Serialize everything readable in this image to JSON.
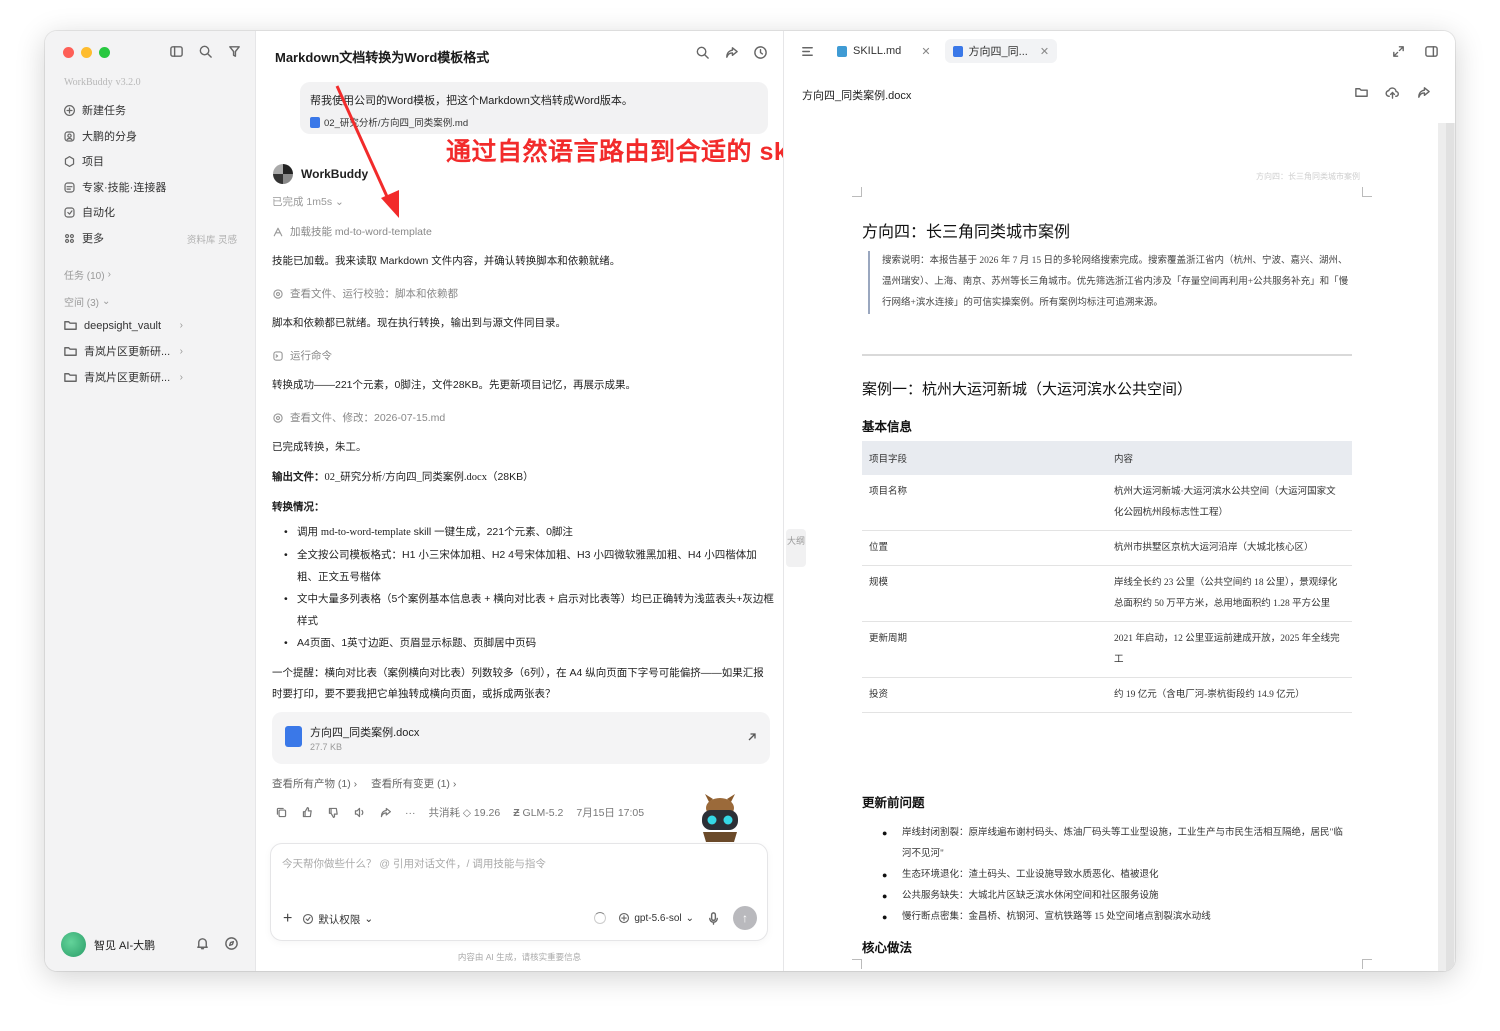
{
  "sidebar": {
    "brand": "WorkBuddy",
    "version": "v3.2.0",
    "nav": [
      {
        "label": "新建任务",
        "icon": "plus-circle-icon"
      },
      {
        "label": "大鹏的分身",
        "icon": "avatar-icon"
      },
      {
        "label": "项目",
        "icon": "project-icon"
      },
      {
        "label": "专家·技能·连接器",
        "icon": "expert-icon"
      },
      {
        "label": "自动化",
        "icon": "automation-icon"
      },
      {
        "label": "更多",
        "icon": "grid-icon",
        "extra": "资料库 灵感"
      }
    ],
    "tasks_label": "任务 (10)",
    "spaces_label": "空间 (3)",
    "folders": [
      "deepsight_vault",
      "青岚片区更新研...",
      "青岚片区更新研..."
    ],
    "user_name": "智见 AI-大鹏"
  },
  "chat": {
    "title": "Markdown文档转换为Word模板格式",
    "user_message": "帮我使用公司的Word模板，把这个Markdown文档转成Word版本。",
    "attachment": "02_研究分析/方向四_同类案例.md",
    "annotation": "通过自然语言路由到合适的 skill",
    "bot_name": "WorkBuddy",
    "done": "已完成 1m5s",
    "steps": {
      "load_skill": "加载技能 md-to-word-template",
      "check_env": "查看文件、运行校验：脚本和依赖都",
      "run_cmd": "运行命令",
      "check_file": "查看文件、修改：2026-07-15.md"
    },
    "paragraphs": {
      "p1": "技能已加载。我来读取 Markdown 文件内容，并确认转换脚本和依赖就绪。",
      "p2": "脚本和依赖都已就绪。现在执行转换，输出到与源文件同目录。",
      "p3": "转换成功——221个元素，0脚注，文件28KB。先更新项目记忆，再展示成果。",
      "p4": "已完成转换，朱工。",
      "output_label": "输出文件：",
      "output_path": "02_研究分析/方向四_同类案例.docx",
      "output_size": "（28KB）",
      "summary_label": "转换情况：",
      "reminder": "一个提醒：横向对比表（案例横向对比表）列数较多（6列），在 A4 纵向页面下字号可能偏挤——如果汇报时要打印，要不要我把它单独转成横向页面，或拆成两张表？"
    },
    "bullets": [
      {
        "pre": "调用 ",
        "code": "md-to-word-template",
        "post": " skill 一键生成，221个元素、0脚注"
      },
      {
        "pre": "全文按公司模板格式：H1 小三宋体加粗、H2 4号宋体加粗、H3 小四微软雅黑加粗、H4 小四楷体加粗、正文五号楷体",
        "code": "",
        "post": ""
      },
      {
        "pre": "文中大量多列表格（5个案例基本信息表 + 横向对比表 + 启示对比表等）均已正确转为浅蓝表头+灰边框样式",
        "code": "",
        "post": ""
      },
      {
        "pre": "A4页面、1英寸边距、页眉显示标题、页脚居中页码",
        "code": "",
        "post": ""
      }
    ],
    "file_card": {
      "name": "方向四_同类案例.docx",
      "size": "27.7 KB"
    },
    "links": [
      "查看所有产物 (1) ›",
      "查看所有变更 (1) ›"
    ],
    "meta": {
      "cost": "共消耗 ◇ 19.26",
      "model": "GLM-5.2",
      "time": "7月15日 17:05"
    },
    "input_placeholder": "今天帮你做些什么？ @ 引用对话文件，/ 调用技能与指令",
    "permission": "默认权限",
    "model_select": "gpt-5.6-sol",
    "disclaimer": "内容由 AI 生成，请核实重要信息",
    "collapse_tab": "大纲"
  },
  "doc": {
    "tabs": [
      {
        "label": "SKILL.md",
        "icon": "markdown-icon",
        "color": "#3f9bd4"
      },
      {
        "label": "方向四_同...",
        "icon": "word-doc-icon",
        "color": "#3a78e8"
      }
    ],
    "file_name": "方向四_同类案例.docx",
    "running_header": "方向四：长三角同类城市案例",
    "h1": "方向四：长三角同类城市案例",
    "quote": "搜索说明：本报告基于 2026 年 7 月 15 日的多轮网络搜索完成。搜索覆盖浙江省内（杭州、宁波、嘉兴、湖州、温州瑞安）、上海、南京、苏州等长三角城市。优先筛选浙江省内涉及「存量空间再利用+公共服务补充」和「慢行网络+滨水连接」的可信实操案例。所有案例均标注可追溯来源。",
    "h2": "案例一：杭州大运河新城（大运河滨水公共空间）",
    "basic_info": "基本信息",
    "table": {
      "headers": [
        "项目字段",
        "内容"
      ],
      "rows": [
        [
          "项目名称",
          "杭州大运河新城·大运河滨水公共空间（大运河国家文化公园杭州段标志性工程）"
        ],
        [
          "位置",
          "杭州市拱墅区京杭大运河沿岸（大城北核心区）"
        ],
        [
          "规模",
          "岸线全长约 23 公里（公共空间约 18 公里），景观绿化总面积约 50 万平方米，总用地面积约 1.28 平方公里"
        ],
        [
          "更新周期",
          "2021 年启动，12 公里亚运前建成开放，2025 年全线完工"
        ],
        [
          "投资",
          "约 19 亿元（含电厂河-崇杭街段约 14.9 亿元）"
        ]
      ]
    },
    "issues_title": "更新前问题",
    "issues": [
      "岸线封闭割裂：原岸线遍布谢村码头、炼油厂码头等工业型设施，工业生产与市民生活相互隔绝，居民\"临河不见河\"",
      "生态环境退化：渣土码头、工业设施导致水质恶化、植被退化",
      "公共服务缺失：大城北片区缺乏滨水休闲空间和社区服务设施",
      "慢行断点密集：金昌桥、杭钢河、宣杭铁路等 15 处空间堵点割裂滨水动线"
    ],
    "core_title": "核心做法"
  }
}
